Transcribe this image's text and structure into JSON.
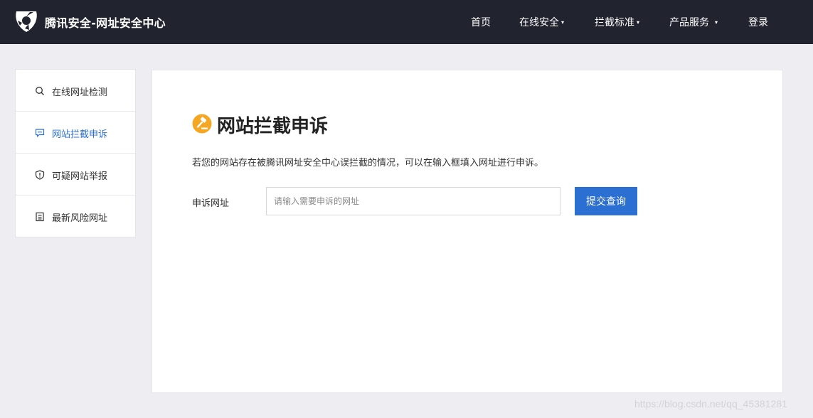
{
  "header": {
    "brand": "腾讯安全-网址安全中心",
    "nav": {
      "home": "首页",
      "online_security": "在线安全",
      "block_standard": "拦截标准",
      "product_service": "产品服务",
      "login": "登录",
      "caret": "▾"
    }
  },
  "sidebar": {
    "items": [
      {
        "label": "在线网址检测",
        "icon": "search-icon"
      },
      {
        "label": "网站拦截申诉",
        "icon": "chat-icon",
        "active": true
      },
      {
        "label": "可疑网站举报",
        "icon": "shield-icon"
      },
      {
        "label": "最新风险网址",
        "icon": "document-icon"
      }
    ]
  },
  "main": {
    "title": "网站拦截申诉",
    "description": "若您的网站存在被腾讯网址安全中心误拦截的情况，可以在输入框填入网址进行申诉。",
    "field_label": "申诉网址",
    "input_placeholder": "请输入需要申诉的网址",
    "input_value": "",
    "submit_label": "提交查询"
  },
  "watermark": "https://blog.csdn.net/qq_45381281",
  "colors": {
    "header_bg": "#21232f",
    "accent": "#2b6fd3",
    "title_icon": "#f5a623",
    "page_bg": "#eeeef2"
  }
}
